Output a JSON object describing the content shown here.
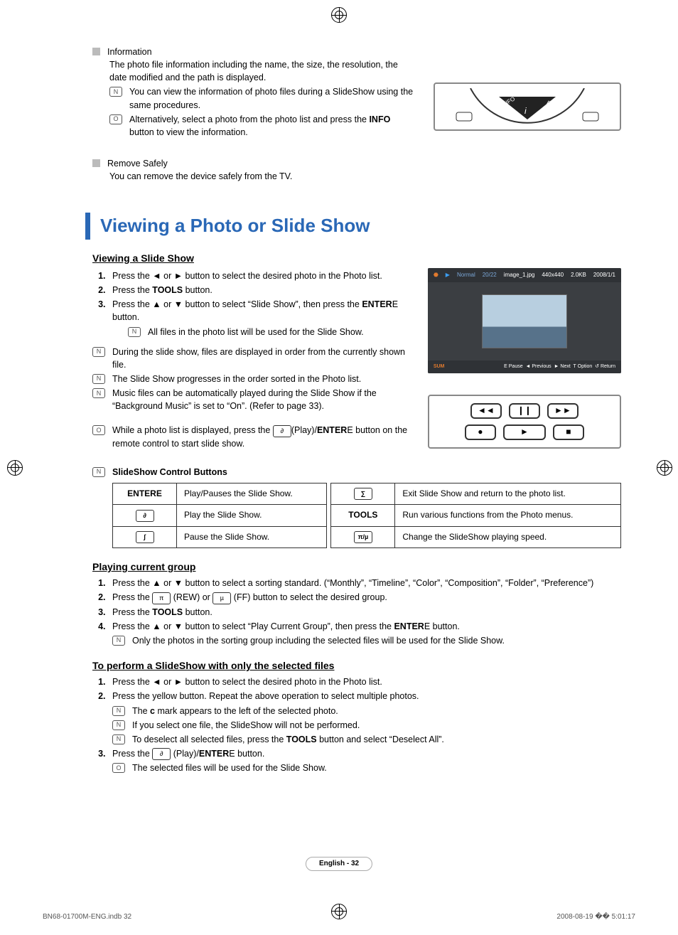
{
  "info_section": {
    "heading": "Information",
    "desc": "The photo file information including the name, the size, the resolution, the date modified and the path is displayed.",
    "note1": "You can view the information of photo files during a SlideShow using the same procedures.",
    "note2_pre": "Alternatively, select a photo from the photo list and press the ",
    "note2_bold": "INFO",
    "note2_post": " button to view the information."
  },
  "remove_section": {
    "heading": "Remove Safely",
    "desc": "You can remove the device safely from the TV."
  },
  "main_title": "Viewing a Photo or Slide Show",
  "viewing": {
    "heading": "Viewing a Slide Show",
    "s1": "Press the ◄ or ► button to select the desired photo in the Photo list.",
    "s2_pre": "Press the ",
    "s2_bold": "TOOLS",
    "s2_post": " button.",
    "s3_pre": "Press the ▲ or ▼ button to select “Slide Show”, then press the ",
    "s3_bold": "ENTER",
    "s3_post": " button.",
    "s3_note": "All files in the photo list will be used for the Slide Show.",
    "bul1": "During the slide show, files are displayed in order from the currently shown file.",
    "bul2": "The Slide Show progresses in the order sorted in the Photo list.",
    "bul3": "Music files can be automatically played during the Slide Show if the “Background Music” is set to “On”. (Refer to page 33).",
    "bul4_pre": "While a photo list is displayed, press the ",
    "bul4_mid": "(Play)/",
    "bul4_bold": "ENTER",
    "bul4_post": " button on the remote control to start slide show."
  },
  "tv": {
    "normal": "Normal",
    "count": "20/22",
    "file": "image_1.jpg",
    "res": "440x440",
    "size": "2.0KB",
    "date": "2008/1/1",
    "sum": "SUM",
    "pause": "Pause",
    "prev": "Previous",
    "next": "Next",
    "option": "Option",
    "return": "Return"
  },
  "ctrl": {
    "title": "SlideShow Control Buttons",
    "r1k": "ENTER",
    "r1v": "Play/Pauses the Slide Show.",
    "r2v": "Play the Slide Show.",
    "r3v": "Pause the Slide Show.",
    "r1k2": "■",
    "r1v2": "Exit Slide Show and return to the photo list.",
    "r2k2": "TOOLS",
    "r2v2": "Run various functions from the Photo menus.",
    "r3k2": "◄◄/►►",
    "r3v2": "Change the SlideShow playing speed."
  },
  "play_group": {
    "heading": "Playing current group",
    "s1": "Press the ▲ or ▼ button to select a sorting standard. (“Monthly”, “Timeline”, “Color”, “Composition”, “Folder”, “Preference”)",
    "s2_pre": "Press the ",
    "s2_mid": " (REW) or ",
    "s2_post": " (FF) button to select the desired group.",
    "s3_pre": "Press the ",
    "s3_bold": "TOOLS",
    "s3_post": " button.",
    "s4_pre": "Press the ▲ or ▼ button to select “Play Current Group”, then press the ",
    "s4_bold": "ENTER",
    "s4_post": " button.",
    "s4_note": "Only the photos in the sorting group including the selected files will be used for the Slide Show."
  },
  "selected": {
    "heading": "To perform a SlideShow with only the selected files",
    "s1": "Press the ◄ or ► button to select the desired photo in the Photo list.",
    "s2": "Press the yellow button. Repeat the above operation to select multiple photos.",
    "s2_n1_pre": "The ",
    "s2_n1_post": " mark appears to the left of the selected photo.",
    "s2_n2": "If you select one file, the SlideShow will not be performed.",
    "s2_n3_pre": "To deselect all selected files, press the ",
    "s2_n3_bold": "TOOLS",
    "s2_n3_post": " button and select “Deselect All”.",
    "s3_pre": "Press the ",
    "s3_mid": " (Play)/",
    "s3_bold": "ENTER",
    "s3_post": " button.",
    "s3_note": "The selected files will be used for the Slide Show."
  },
  "page": "English - 32",
  "footer_left": "BN68-01700M-ENG.indb   32",
  "footer_right": "2008-08-19   �� 5:01:17"
}
